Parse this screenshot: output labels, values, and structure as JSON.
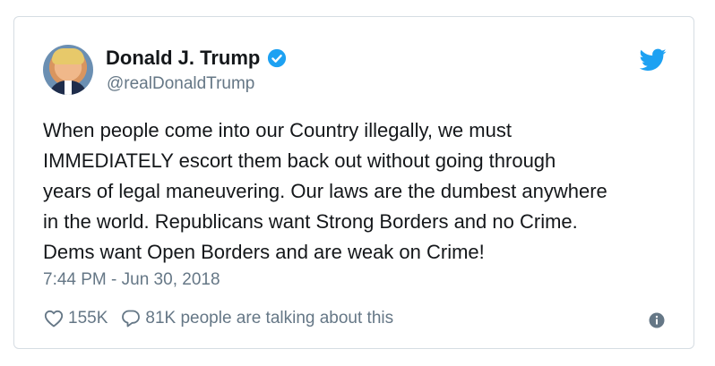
{
  "author": {
    "name": "Donald J. Trump",
    "handle": "@realDonaldTrump",
    "avatar_icon": "profile-photo",
    "verified_icon": "verified-badge-icon",
    "verified_color": "#1da1f2"
  },
  "brand": {
    "icon": "twitter-bird-icon",
    "color": "#1da1f2"
  },
  "tweet": {
    "lines": [
      "When people come into our Country illegally, we must",
      "IMMEDIATELY escort them back out without going through",
      "years of legal maneuvering. Our laws are the dumbest anywhere",
      "in the world. Republicans want Strong Borders and no Crime.",
      "Dems want Open Borders and are weak on Crime!"
    ],
    "timestamp": "7:44 PM - Jun 30, 2018"
  },
  "actions": {
    "likes": "155K",
    "like_icon": "heart-icon",
    "replies_text": "81K people are talking about this",
    "reply_icon": "speech-bubble-icon",
    "info_icon": "info-icon"
  },
  "colors": {
    "text": "#14171a",
    "secondary": "#657786",
    "border": "#d6dde3"
  }
}
